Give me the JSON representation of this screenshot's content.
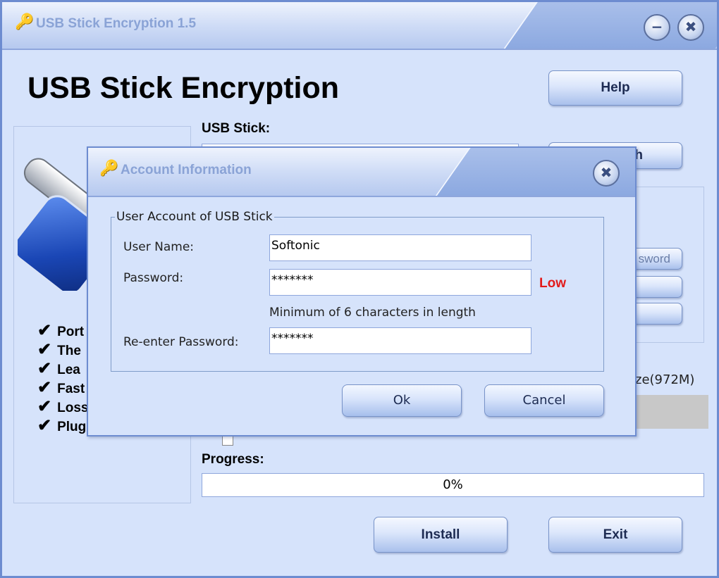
{
  "window": {
    "title": "USB Stick Encryption 1.5"
  },
  "app_heading": "USB Stick Encryption",
  "buttons": {
    "help": "Help",
    "hidden_right_1": "h",
    "password_partial": "sword",
    "install": "Install",
    "exit": "Exit"
  },
  "labels": {
    "usb_stick": "USB Stick:",
    "progress": "Progress:",
    "size": "ze(972M)"
  },
  "features": [
    "Port",
    "The",
    "Lea",
    "Fast",
    "Loss",
    "Plug"
  ],
  "progress": {
    "value": 0,
    "text": "0%"
  },
  "dialog": {
    "title": "Account Information",
    "group_title": "User Account of USB Stick",
    "username_label": "User Name:",
    "username_value": "Softonic",
    "password_label": "Password:",
    "password_value": "*******",
    "strength": "Low",
    "hint": "Minimum of 6 characters in length",
    "reenter_label": "Re-enter Password:",
    "reenter_value": "*******",
    "ok": "Ok",
    "cancel": "Cancel"
  },
  "icons": {
    "app": "usb-key-icon",
    "minimize": "minimize-icon",
    "close": "close-icon",
    "check": "checkmark-icon"
  }
}
